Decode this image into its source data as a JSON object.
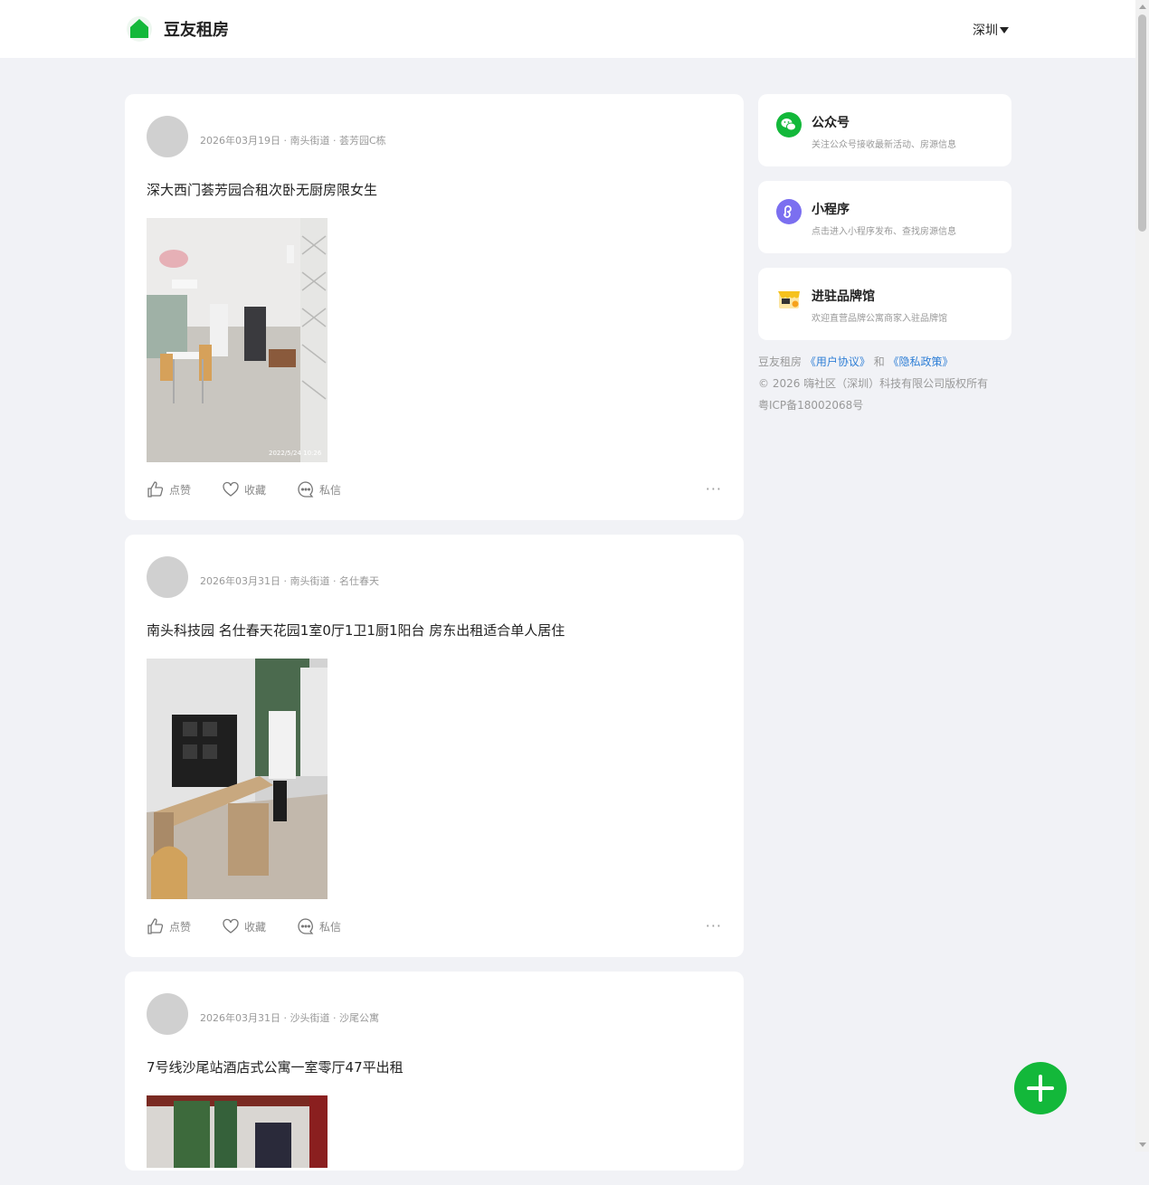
{
  "header": {
    "brand": "豆友租房",
    "city": "深圳",
    "logo_icon": "house-icon"
  },
  "posts": [
    {
      "meta": "2026年03月19日 · 南头街道 · 荟芳园C栋",
      "title": "深大西门荟芳园合租次卧无厨房限女生",
      "photo_stamp": "2022/5/24 10:26",
      "like_label": "点赞",
      "fav_label": "收藏",
      "msg_label": "私信",
      "more": "···"
    },
    {
      "meta": "2026年03月31日 · 南头街道 · 名仕春天",
      "title": "南头科技园 名仕春天花园1室0厅1卫1厨1阳台 房东出租适合单人居住",
      "like_label": "点赞",
      "fav_label": "收藏",
      "msg_label": "私信",
      "more": "···"
    },
    {
      "meta": "2026年03月31日 · 沙头街道 · 沙尾公寓",
      "title": "7号线沙尾站酒店式公寓一室零厅47平出租"
    }
  ],
  "sidebar": {
    "cards": [
      {
        "title": "公众号",
        "desc": "关注公众号接收最新活动、房源信息",
        "icon": "wechat-icon",
        "color": "#13b83a"
      },
      {
        "title": "小程序",
        "desc": "点击进入小程序发布、查找房源信息",
        "icon": "mini-program-icon",
        "color": "#7b6ff0"
      },
      {
        "title": "进驻品牌馆",
        "desc": "欢迎直营品牌公寓商家入驻品牌馆",
        "icon": "shop-icon",
        "color": "#f6c21c"
      }
    ],
    "footer": {
      "brand": "豆友租房",
      "agreement": "《用户协议》",
      "and": "和",
      "privacy": "《隐私政策》",
      "copyright": "© 2026 嗨社区（深圳）科技有限公司版权所有",
      "icp": "粤ICP备18002068号"
    }
  },
  "colors": {
    "accent": "#13b83a",
    "link": "#2f7fd6",
    "background": "#f1f2f6"
  }
}
